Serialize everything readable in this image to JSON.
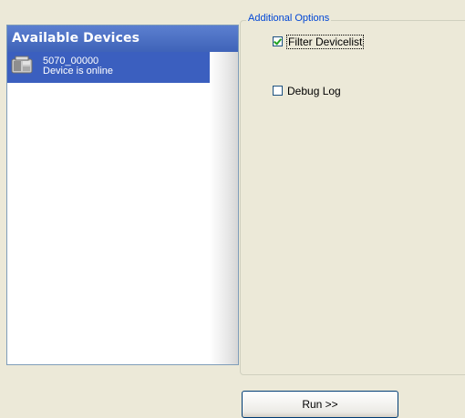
{
  "devices": {
    "title": "Available Devices",
    "items": [
      {
        "name": "5070_00000",
        "status": "Device is online",
        "icon": "device-icon"
      }
    ]
  },
  "options": {
    "legend": "Additional Options",
    "filter_devicelist": {
      "label": "Filter Devicelist",
      "checked": true
    },
    "debug_log": {
      "label": "Debug Log",
      "checked": false
    }
  },
  "actions": {
    "run_label": "Run >>"
  },
  "colors": {
    "header_blue": "#4a6fc6",
    "selection_blue": "#3b5fbf",
    "legend_text": "#0046d5",
    "window_bg": "#ece9d8"
  }
}
